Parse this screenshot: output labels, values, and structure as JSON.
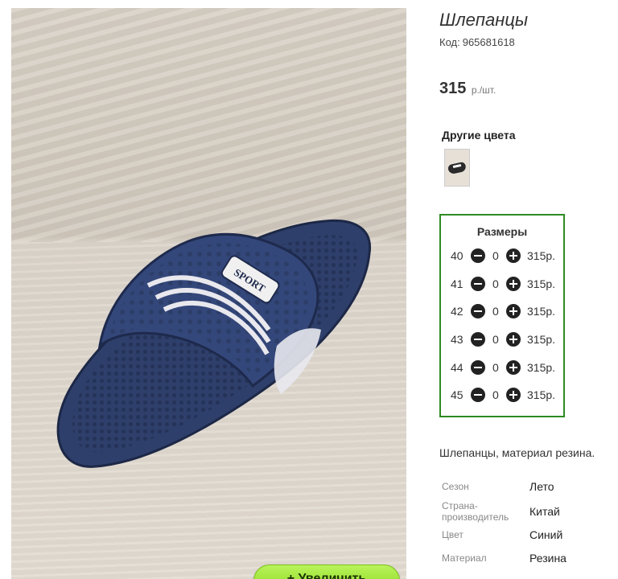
{
  "product": {
    "title": "Шлепанцы",
    "code_label": "Код:",
    "code_value": "965681618",
    "price": "315",
    "price_unit": "р./шт.",
    "zoom_button": "+  Увеличить"
  },
  "other_colors": {
    "title": "Другие цвета"
  },
  "sizes": {
    "title": "Размеры",
    "rows": [
      {
        "size": "40",
        "qty": "0",
        "price": "315р."
      },
      {
        "size": "41",
        "qty": "0",
        "price": "315р."
      },
      {
        "size": "42",
        "qty": "0",
        "price": "315р."
      },
      {
        "size": "43",
        "qty": "0",
        "price": "315р."
      },
      {
        "size": "44",
        "qty": "0",
        "price": "315р."
      },
      {
        "size": "45",
        "qty": "0",
        "price": "315р."
      }
    ]
  },
  "description": "Шлепанцы, материал резина.",
  "properties": [
    {
      "key": "Сезон",
      "value": "Лето"
    },
    {
      "key": "Страна-\nпроизводитель",
      "value": "Китай"
    },
    {
      "key": "Цвет",
      "value": "Синий"
    },
    {
      "key": "Материал",
      "value": "Резина"
    }
  ],
  "colors": {
    "accent_green": "#2e8b22",
    "button_green": "#84d418",
    "slipper_navy": "#2b3a63"
  }
}
